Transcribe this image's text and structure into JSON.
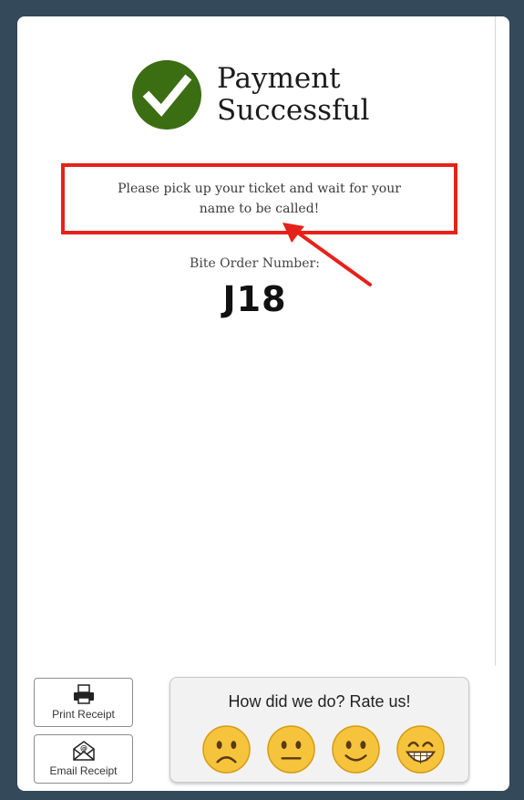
{
  "header": {
    "title_line1": "Payment",
    "title_line2": "Successful"
  },
  "notice": {
    "text": "Please pick up your ticket and wait for your name to be called!"
  },
  "order": {
    "label": "Bite Order Number:",
    "number": "J18"
  },
  "receipts": {
    "print_label": "Print Receipt",
    "email_label": "Email Receipt"
  },
  "rating": {
    "title": "How did we do? Rate us!",
    "options": [
      {
        "icon": "frowning-face-icon"
      },
      {
        "icon": "neutral-face-icon"
      },
      {
        "icon": "slightly-smiling-face-icon"
      },
      {
        "icon": "grinning-face-icon"
      }
    ]
  },
  "colors": {
    "background": "#34495a",
    "success_green": "#3b6e12",
    "highlight_red": "#e52219"
  }
}
